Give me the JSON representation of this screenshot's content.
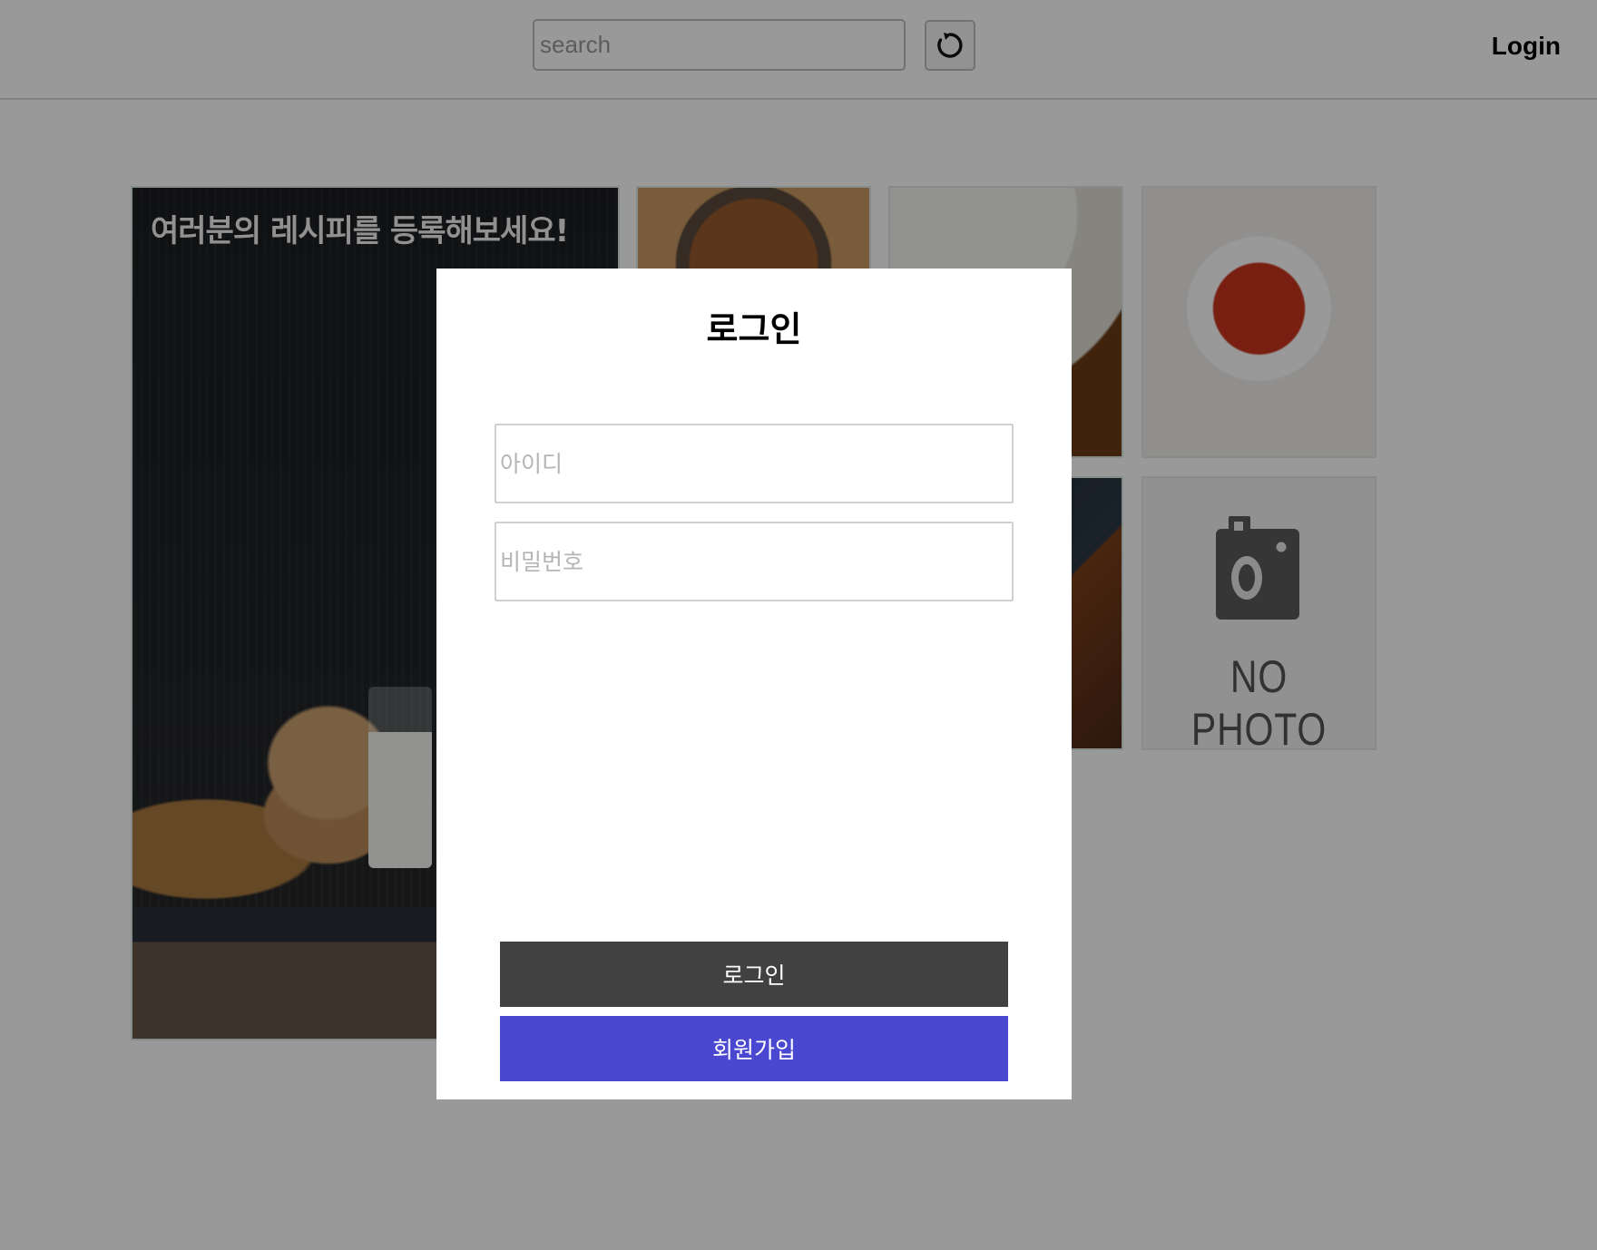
{
  "header": {
    "search_placeholder": "search",
    "refresh_icon": "refresh-icon",
    "login_label": "Login"
  },
  "hero": {
    "text": "여러분의 레시피를 등록해보세요!"
  },
  "no_photo": {
    "text": "NO PHOTO",
    "icon": "camera-icon"
  },
  "modal": {
    "title": "로그인",
    "id_placeholder": "아이디",
    "password_placeholder": "비밀번호",
    "login_button": "로그인",
    "signup_button": "회원가입"
  },
  "colors": {
    "login_button_bg": "#414141",
    "signup_button_bg": "#4a47d0",
    "overlay": "rgba(0,0,0,0.40)"
  }
}
